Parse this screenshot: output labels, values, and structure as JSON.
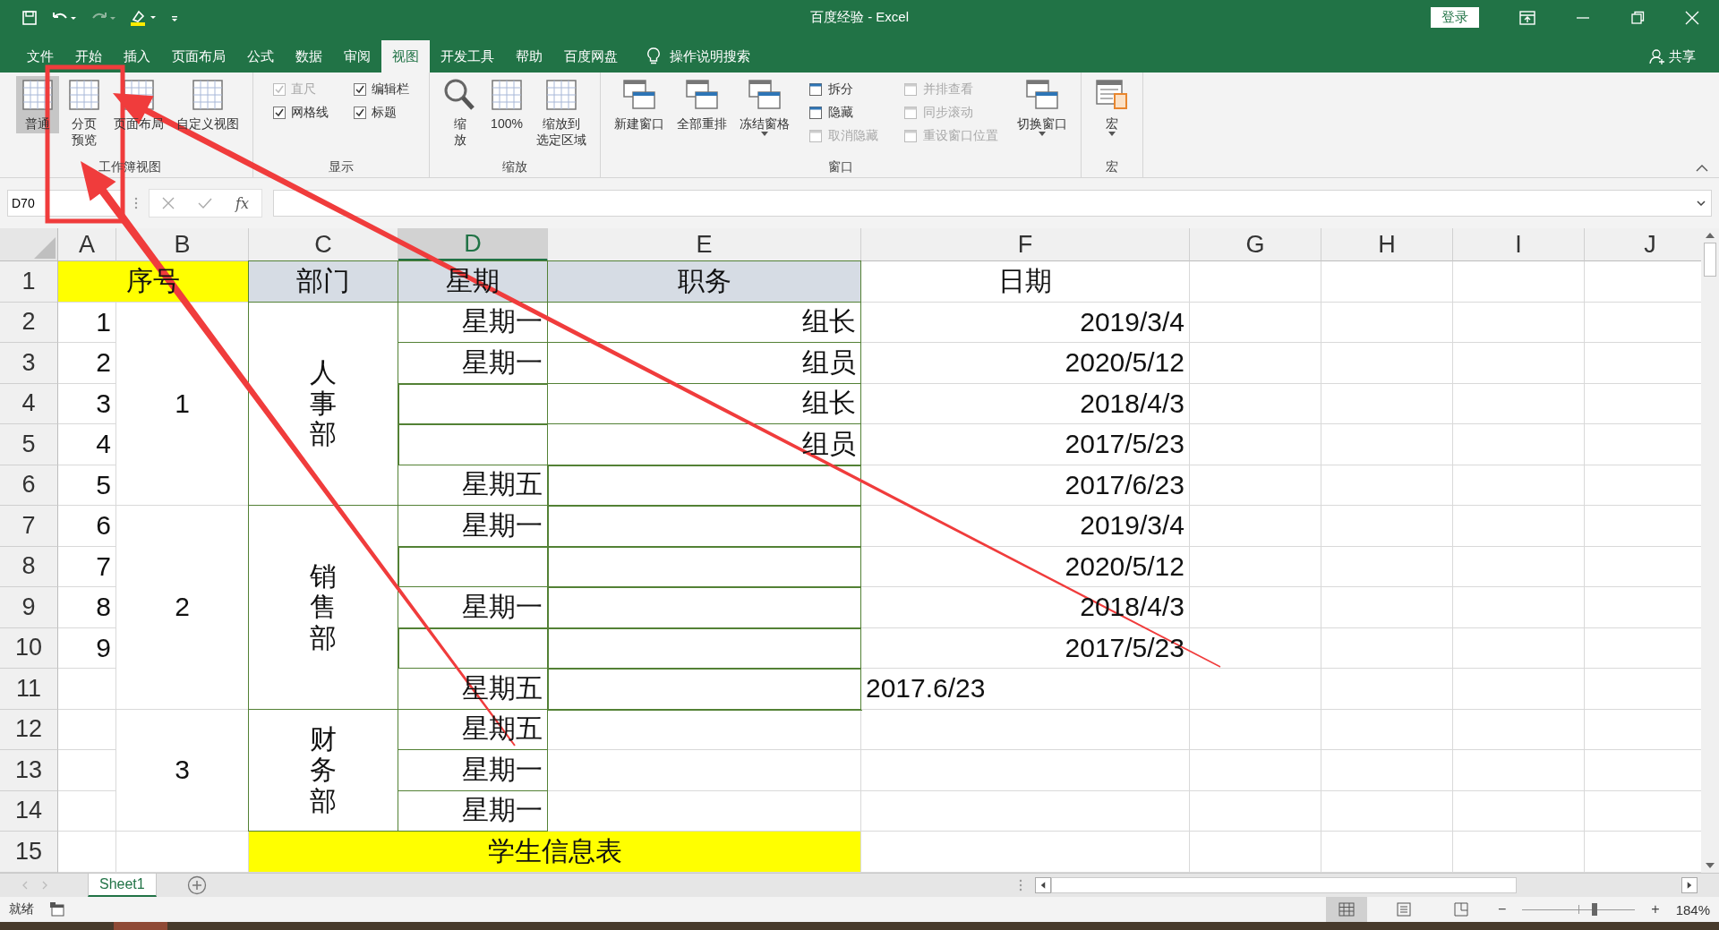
{
  "window": {
    "title": "百度经验  -  Excel",
    "login": "登录"
  },
  "ribbon_tabs": [
    {
      "label": "文件",
      "selected": false
    },
    {
      "label": "开始",
      "selected": false
    },
    {
      "label": "插入",
      "selected": false
    },
    {
      "label": "页面布局",
      "selected": false
    },
    {
      "label": "公式",
      "selected": false
    },
    {
      "label": "数据",
      "selected": false
    },
    {
      "label": "审阅",
      "selected": false
    },
    {
      "label": "视图",
      "selected": true
    },
    {
      "label": "开发工具",
      "selected": false
    },
    {
      "label": "帮助",
      "selected": false
    },
    {
      "label": "百度网盘",
      "selected": false
    }
  ],
  "tell_me": "操作说明搜索",
  "share": "共享",
  "ribbon_groups": [
    {
      "label": "工作簿视图",
      "items": [
        {
          "kind": "large",
          "lines": [
            "普通"
          ],
          "selected": true
        },
        {
          "kind": "large",
          "lines": [
            "分页",
            "预览"
          ],
          "selected": false
        },
        {
          "kind": "large",
          "lines": [
            "页面布局"
          ],
          "selected": false
        },
        {
          "kind": "large",
          "lines": [
            "自定义视图"
          ],
          "selected": false
        }
      ]
    },
    {
      "label": "显示",
      "items": [
        {
          "kind": "stack",
          "items": [
            {
              "kind": "check",
              "label": "直尺",
              "checked": true,
              "disabled": true
            },
            {
              "kind": "check",
              "label": "网格线",
              "checked": true,
              "disabled": false
            }
          ]
        },
        {
          "kind": "stack",
          "items": [
            {
              "kind": "check",
              "label": "编辑栏",
              "checked": true,
              "disabled": false
            },
            {
              "kind": "check",
              "label": "标题",
              "checked": true,
              "disabled": false
            }
          ]
        }
      ]
    },
    {
      "label": "缩放",
      "items": [
        {
          "kind": "large",
          "lines": [
            "缩",
            "放"
          ],
          "selected": false
        },
        {
          "kind": "large",
          "lines": [
            "100%"
          ],
          "selected": false
        },
        {
          "kind": "large",
          "lines": [
            "缩放到",
            "选定区域"
          ],
          "selected": false
        }
      ]
    },
    {
      "label": "窗口",
      "items": [
        {
          "kind": "large",
          "lines": [
            "新建窗口"
          ],
          "selected": false
        },
        {
          "kind": "large",
          "lines": [
            "全部重排"
          ],
          "selected": false
        },
        {
          "kind": "large",
          "lines": [
            "冻结窗格"
          ],
          "selected": false,
          "dropdown": true
        },
        {
          "kind": "stack",
          "items": [
            {
              "kind": "small",
              "label": "拆分",
              "disabled": false
            },
            {
              "kind": "small",
              "label": "隐藏",
              "disabled": false
            },
            {
              "kind": "small",
              "label": "取消隐藏",
              "disabled": true
            }
          ]
        },
        {
          "kind": "stack",
          "items": [
            {
              "kind": "small",
              "label": "并排查看",
              "disabled": true
            },
            {
              "kind": "small",
              "label": "同步滚动",
              "disabled": true
            },
            {
              "kind": "small",
              "label": "重设窗口位置",
              "disabled": true
            }
          ]
        },
        {
          "kind": "large",
          "lines": [
            "切换窗口"
          ],
          "selected": false,
          "dropdown": true
        }
      ]
    },
    {
      "label": "宏",
      "items": [
        {
          "kind": "large",
          "lines": [
            "宏"
          ],
          "selected": false,
          "dropdown": true
        }
      ]
    }
  ],
  "formula_bar": {
    "name_box": "D70",
    "fx": "fx"
  },
  "columns": [
    {
      "label": "A",
      "selected": false
    },
    {
      "label": "B",
      "selected": false
    },
    {
      "label": "C",
      "selected": false
    },
    {
      "label": "D",
      "selected": true
    },
    {
      "label": "E",
      "selected": false
    },
    {
      "label": "F",
      "selected": false
    },
    {
      "label": "G",
      "selected": false
    },
    {
      "label": "H",
      "selected": false
    },
    {
      "label": "I",
      "selected": false
    },
    {
      "label": "J",
      "selected": false
    }
  ],
  "rows": [
    {
      "header": "1",
      "cells": [
        {
          "kind": "center",
          "text": "序号",
          "color": "#ffff00"
        },
        {
          "kind": "joinleft"
        },
        {
          "kind": "center",
          "text": "部门",
          "color": "#d6dce4",
          "framed": true
        },
        {
          "kind": "center",
          "text": "星期",
          "color": "#d6dce4",
          "framed": true
        },
        {
          "kind": "center",
          "text": "职务",
          "color": "#d6dce4",
          "framed": true
        },
        {
          "kind": "center",
          "text": "日期"
        }
      ]
    },
    {
      "header": "2",
      "cells": [
        {
          "kind": "right",
          "text": "1"
        },
        {
          "kind": "center",
          "text": "1"
        },
        {
          "kind": "stack",
          "text": "人事部",
          "framed": true
        },
        {
          "kind": "right",
          "text": "星期一",
          "framed": true
        },
        {
          "kind": "right",
          "text": "组长",
          "framed": true
        },
        {
          "kind": "right",
          "text": "2019/3/4"
        }
      ]
    },
    {
      "header": "3",
      "cells": [
        {
          "kind": "right",
          "text": "2"
        },
        {
          "kind": "joinup"
        },
        {
          "kind": "joinup"
        },
        {
          "kind": "right",
          "text": "星期一",
          "framed": true
        },
        {
          "kind": "right",
          "text": "组员",
          "framed": true
        },
        {
          "kind": "right",
          "text": "2020/5/12"
        }
      ]
    },
    {
      "header": "4",
      "cells": [
        {
          "kind": "right",
          "text": "3"
        },
        {
          "kind": "joinup"
        },
        {
          "kind": "joinup"
        },
        {
          "kind": "empty",
          "framed": true
        },
        {
          "kind": "right",
          "text": "组长",
          "framed": true
        },
        {
          "kind": "right",
          "text": "2018/4/3"
        }
      ]
    },
    {
      "header": "5",
      "cells": [
        {
          "kind": "right",
          "text": "4"
        },
        {
          "kind": "joinup"
        },
        {
          "kind": "joinup"
        },
        {
          "kind": "empty",
          "framed": true
        },
        {
          "kind": "right",
          "text": "组员",
          "framed": true
        },
        {
          "kind": "right",
          "text": "2017/5/23"
        }
      ]
    },
    {
      "header": "6",
      "cells": [
        {
          "kind": "right",
          "text": "5"
        },
        {
          "kind": "joinup"
        },
        {
          "kind": "joinup"
        },
        {
          "kind": "right",
          "text": "星期五",
          "framed": true
        },
        {
          "kind": "empty",
          "framed": true
        },
        {
          "kind": "right",
          "text": "2017/6/23"
        }
      ]
    },
    {
      "header": "7",
      "cells": [
        {
          "kind": "right",
          "text": "6"
        },
        {
          "kind": "center",
          "text": "2"
        },
        {
          "kind": "stack",
          "text": "销售部",
          "framed": true
        },
        {
          "kind": "right",
          "text": "星期一",
          "framed": true
        },
        {
          "kind": "empty",
          "framed": true
        },
        {
          "kind": "right",
          "text": "2019/3/4"
        }
      ]
    },
    {
      "header": "8",
      "cells": [
        {
          "kind": "right",
          "text": "7"
        },
        {
          "kind": "joinup"
        },
        {
          "kind": "joinup"
        },
        {
          "kind": "empty",
          "framed": true
        },
        {
          "kind": "empty",
          "framed": true
        },
        {
          "kind": "right",
          "text": "2020/5/12"
        }
      ]
    },
    {
      "header": "9",
      "cells": [
        {
          "kind": "right",
          "text": "8"
        },
        {
          "kind": "joinup"
        },
        {
          "kind": "joinup"
        },
        {
          "kind": "right",
          "text": "星期一",
          "framed": true
        },
        {
          "kind": "empty",
          "framed": true
        },
        {
          "kind": "right",
          "text": "2018/4/3"
        }
      ]
    },
    {
      "header": "10",
      "cells": [
        {
          "kind": "right",
          "text": "9"
        },
        {
          "kind": "joinup"
        },
        {
          "kind": "joinup"
        },
        {
          "kind": "empty",
          "framed": true
        },
        {
          "kind": "empty",
          "framed": true
        },
        {
          "kind": "right",
          "text": "2017/5/23"
        }
      ]
    },
    {
      "header": "11",
      "cells": [
        {
          "kind": "empty"
        },
        {
          "kind": "joinup"
        },
        {
          "kind": "joinup"
        },
        {
          "kind": "right",
          "text": "星期五",
          "framed": true
        },
        {
          "kind": "empty",
          "framed": true
        },
        {
          "kind": "left",
          "text": "2017.6/23"
        }
      ]
    },
    {
      "header": "12",
      "cells": [
        {
          "kind": "empty"
        },
        {
          "kind": "center",
          "text": "3"
        },
        {
          "kind": "stack",
          "text": "财务部",
          "framed": true
        },
        {
          "kind": "right",
          "text": "星期五",
          "framed": true
        },
        {
          "kind": "empty"
        },
        {
          "kind": "empty"
        }
      ]
    },
    {
      "header": "13",
      "cells": [
        {
          "kind": "empty"
        },
        {
          "kind": "joinup"
        },
        {
          "kind": "joinup"
        },
        {
          "kind": "right",
          "text": "星期一",
          "framed": true
        },
        {
          "kind": "empty"
        },
        {
          "kind": "empty"
        }
      ]
    },
    {
      "header": "14",
      "cells": [
        {
          "kind": "empty"
        },
        {
          "kind": "joinup"
        },
        {
          "kind": "joinup"
        },
        {
          "kind": "right",
          "text": "星期一",
          "framed": true
        },
        {
          "kind": "empty"
        },
        {
          "kind": "empty"
        }
      ]
    },
    {
      "header": "15",
      "cells": [
        {
          "kind": "empty"
        },
        {
          "kind": "empty"
        },
        {
          "kind": "center",
          "text": "学生信息表",
          "color": "#ffff00"
        },
        {
          "kind": "joinleft"
        },
        {
          "kind": "joinleft"
        },
        {
          "kind": "empty"
        }
      ]
    }
  ],
  "sheets": [
    {
      "label": "Sheet1",
      "selected": true
    }
  ],
  "status": {
    "text": "就绪",
    "views": [
      {
        "selected": true
      },
      {
        "selected": false
      },
      {
        "selected": false
      }
    ],
    "zoom_out": "−",
    "zoom_in": "+",
    "zoom": {
      "level": 0.64
    },
    "zoom_text": "184%"
  },
  "annotations": [
    {
      "kind": "frame"
    },
    {
      "kind": "arrow"
    },
    {
      "kind": "arrow"
    }
  ]
}
